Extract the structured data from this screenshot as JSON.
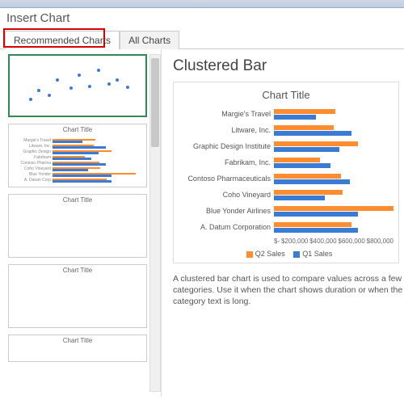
{
  "dialog_title": "Insert Chart",
  "tabs": {
    "recommended": "Recommended Charts",
    "all": "All Charts"
  },
  "thumb_titles": {
    "scatter": "",
    "bar": "Chart Title",
    "col1": "Chart Title",
    "col2": "Chart Title",
    "col3": "Chart Title"
  },
  "preview": {
    "heading": "Clustered Bar",
    "chart_title": "Chart Title",
    "legend": {
      "q2": "Q2 Sales",
      "q1": "Q1 Sales"
    },
    "description": "A clustered bar chart is used to compare values across a few categories. Use it when the chart shows duration or when the category text is long."
  },
  "axis_ticks": [
    "$-",
    "$200,000",
    "$400,000",
    "$600,000",
    "$800,000"
  ],
  "colors": {
    "series_a": "#ff8c2e",
    "series_b": "#3a7bd5",
    "highlight": "#d00"
  },
  "chart_data": {
    "type": "bar",
    "title": "Chart Title",
    "xlabel": "",
    "ylabel": "",
    "xlim": [
      0,
      800000
    ],
    "categories": [
      "Margie's Travel",
      "Litware, Inc.",
      "Graphic Design Institute",
      "Fabrikam, Inc.",
      "Contoso Pharmaceuticals",
      "Coho Vineyard",
      "Blue Yonder Airlines",
      "A. Datum Corporation"
    ],
    "series": [
      {
        "name": "Q2 Sales",
        "color": "#ff8c2e",
        "values": [
          410000,
          400000,
          560000,
          310000,
          450000,
          460000,
          800000,
          520000
        ]
      },
      {
        "name": "Q1 Sales",
        "color": "#3a7bd5",
        "values": [
          280000,
          520000,
          440000,
          380000,
          510000,
          340000,
          560000,
          560000
        ]
      }
    ]
  }
}
